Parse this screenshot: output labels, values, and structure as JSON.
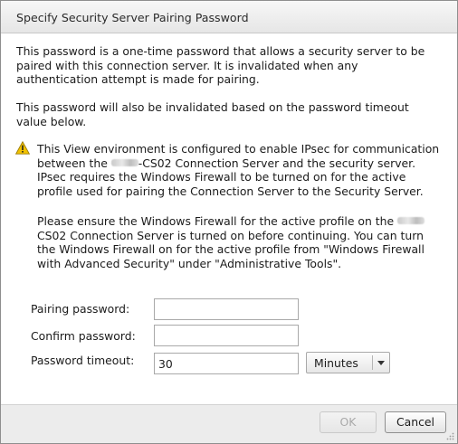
{
  "dialog": {
    "title": "Specify Security Server Pairing Password"
  },
  "intro": {
    "para1_line1": "This password is a one-time password that allows a security server to be",
    "para1_line2": "paired with this connection server. It is invalidated when any",
    "para1_line3": "authentication attempt is made for pairing.",
    "para2_line1": "This password will also be invalidated based on the password timeout",
    "para2_line2": "value below."
  },
  "warning": {
    "icon": "warning-triangle-icon",
    "p1_line1": "This View environment is configured to enable IPsec for communication",
    "p1_line2_before": "between the ",
    "p1_line2_after": "-CS02 Connection Server and the security server.",
    "p1_line3": "IPsec requires the Windows Firewall to be turned on for the active",
    "p1_line4": "profile used for pairing the Connection Server to the Security Server.",
    "p2_line1_before": "Please ensure the Windows Firewall for the active profile on the ",
    "p2_line2": "CS02 Connection Server is turned on before continuing. You can turn",
    "p2_line3": "the Windows Firewall on for the active profile from \"Windows Firewall",
    "p2_line4": "with Advanced Security\" under \"Administrative Tools\"."
  },
  "form": {
    "pairing_password_label": "Pairing password:",
    "pairing_password_value": "",
    "confirm_password_label": "Confirm password:",
    "confirm_password_value": "",
    "timeout_label": "Password timeout:",
    "timeout_value": "30",
    "timeout_unit": "Minutes"
  },
  "footer": {
    "ok_label": "OK",
    "cancel_label": "Cancel"
  },
  "colors": {
    "warning_icon": "#f2c200",
    "ok_disabled_text": "#a9a9a9"
  }
}
